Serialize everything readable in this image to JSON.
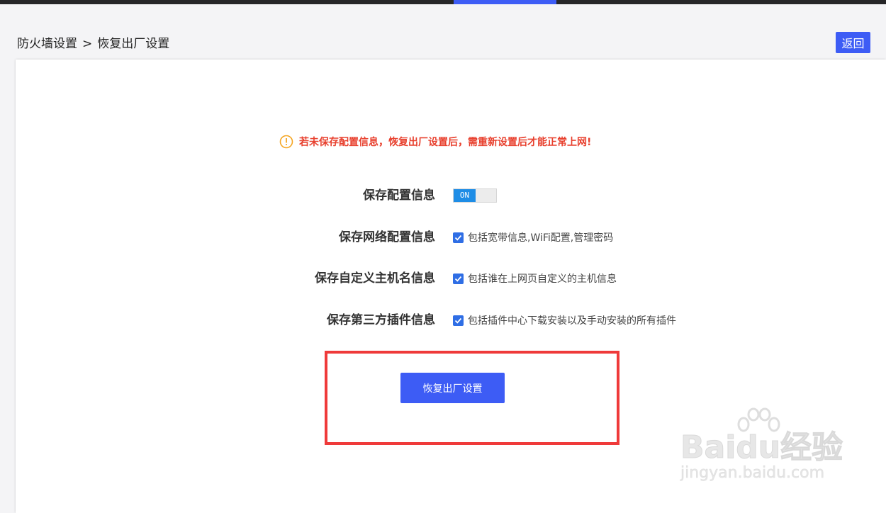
{
  "breadcrumb": {
    "parent": "防火墙设置",
    "separator": ">",
    "current": "恢复出厂设置"
  },
  "header": {
    "back_label": "返回"
  },
  "warning": {
    "text": "若未保存配置信息，恢复出厂设置后，需重新设置后才能正常上网!"
  },
  "options": {
    "save_config": {
      "label": "保存配置信息",
      "toggle_text": "ON",
      "toggle_state": "on"
    },
    "network_config": {
      "label": "保存网络配置信息",
      "description": "包括宽带信息,WiFi配置,管理密码",
      "checked": true
    },
    "hostname": {
      "label": "保存自定义主机名信息",
      "description": "包括谁在上网页自定义的主机信息",
      "checked": true
    },
    "plugins": {
      "label": "保存第三方插件信息",
      "description": "包括插件中心下载安装以及手动安装的所有插件",
      "checked": true
    }
  },
  "actions": {
    "reset_label": "恢复出厂设置"
  },
  "watermark": {
    "brand": "Baidu经验",
    "url": "jingyan.baidu.com"
  },
  "colors": {
    "accent": "#3d5cf5",
    "warning": "#e8412f",
    "warning_icon": "#f5a623",
    "toggle_on": "#1e8de6",
    "checkbox": "#2f6ee5",
    "highlight_frame": "#ef3a3a",
    "topbar": "#262628"
  },
  "icons": {
    "warning": "info-circle-icon",
    "check": "checkmark-icon",
    "watermark_logo": "paw-logo-icon"
  }
}
